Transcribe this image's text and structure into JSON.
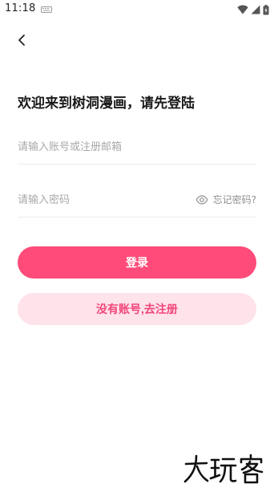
{
  "status_bar": {
    "time": "11:18",
    "icons": [
      "notification-icon",
      "wifi-icon",
      "cellular-signal-icon",
      "battery-charging-icon"
    ]
  },
  "header": {
    "back_icon": "back-arrow-icon"
  },
  "title": "欢迎来到树洞漫画，请先登陆",
  "account_field": {
    "placeholder": "请输入账号或注册邮箱",
    "value": ""
  },
  "password_field": {
    "placeholder": "请输入密码",
    "value": "",
    "toggle_icon": "eye-icon",
    "forgot_label": "忘记密码?"
  },
  "buttons": {
    "login_label": "登录",
    "register_label": "没有账号,去注册"
  },
  "watermark": {
    "text": "大玩客"
  },
  "colors": {
    "primary": "#ff4b79",
    "secondary_bg": "#ffe3ea",
    "secondary_text": "#f2467b",
    "placeholder": "#a9a9a9",
    "divider": "#ededed"
  }
}
